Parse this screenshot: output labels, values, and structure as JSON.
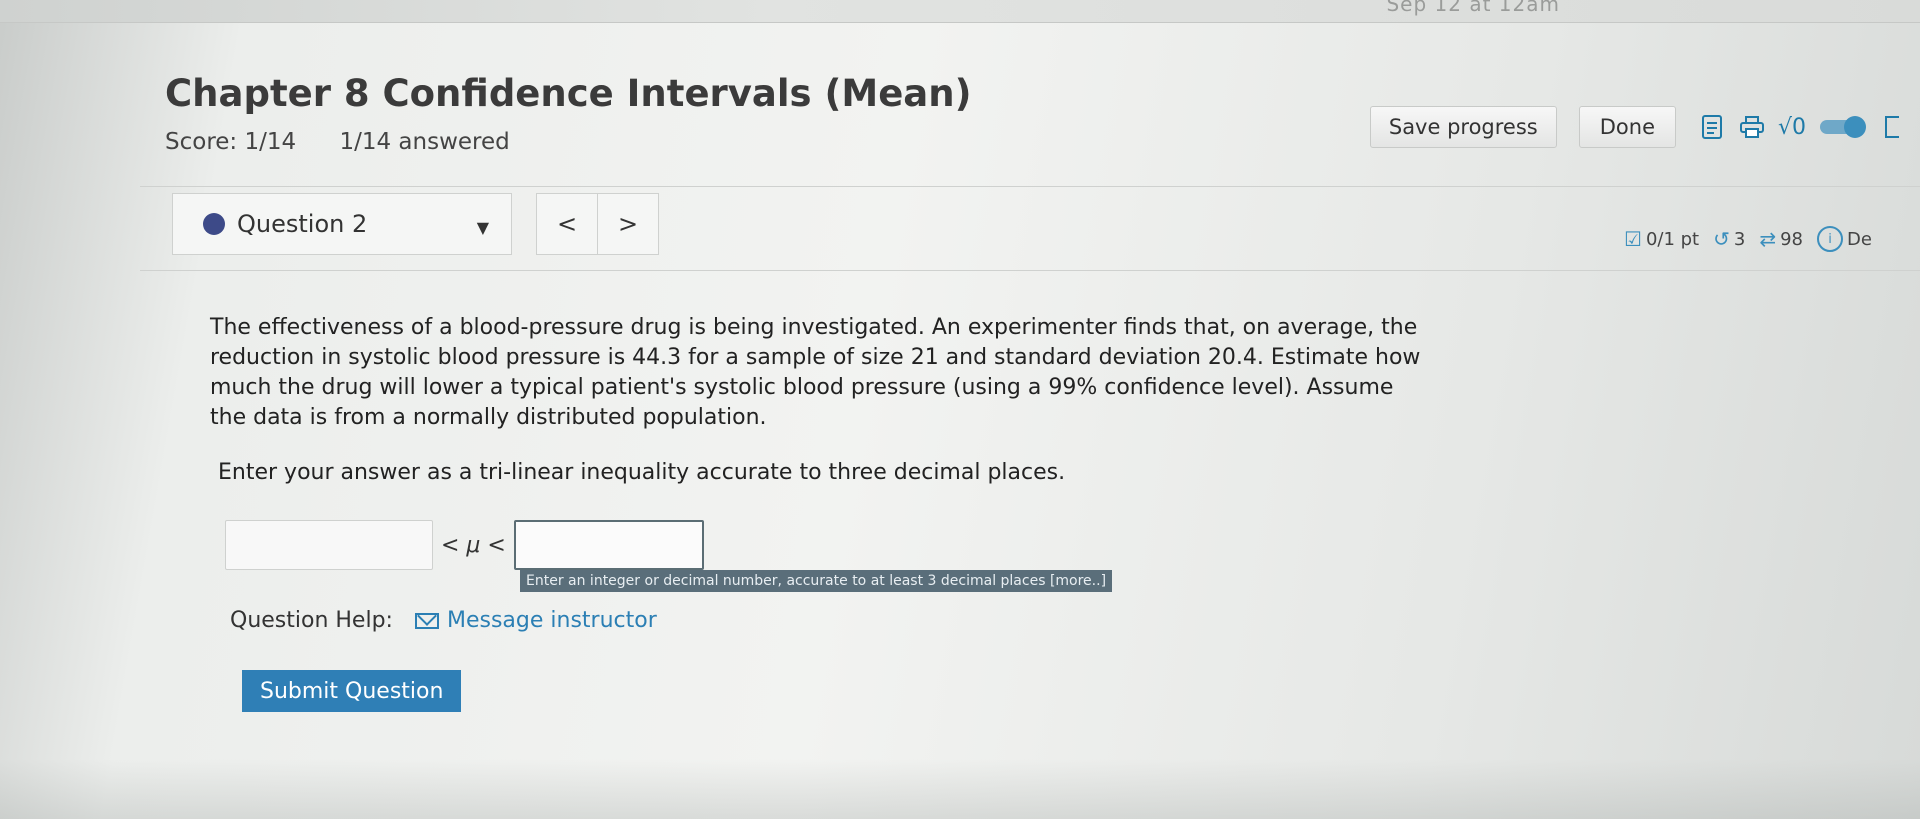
{
  "top_strip": {
    "text": "Sep 12 at 12am"
  },
  "header": {
    "title": "Chapter 8 Confidence Intervals (Mean)",
    "score": "Score: 1/14",
    "answered": "1/14 answered"
  },
  "toolbar": {
    "save_label": "Save progress",
    "done_label": "Done",
    "sqrt_label": "√0"
  },
  "question_nav": {
    "selected": "Question 2",
    "prev": "<",
    "next": ">"
  },
  "meta": {
    "points": "0/1 pt",
    "attempts": "3",
    "submissions": "98",
    "details": "De"
  },
  "question": {
    "text": "The effectiveness of a blood-pressure drug is being investigated. An experimenter finds that, on average, the reduction in systolic blood pressure is 44.3 for a sample of size 21 and standard deviation 20.4. Estimate how much the drug will lower a typical patient's systolic blood pressure (using a 99% confidence level). Assume the data is from a normally distributed population.",
    "instruction": "Enter your answer as a tri-linear inequality accurate to three decimal places."
  },
  "answer": {
    "lower_value": "",
    "inequality": "< μ <",
    "upper_value": "",
    "hint": "Enter an integer or decimal number, accurate to at least 3 decimal places [more..]"
  },
  "help": {
    "label": "Question Help:",
    "link": "Message instructor"
  },
  "submit_label": "Submit Question"
}
